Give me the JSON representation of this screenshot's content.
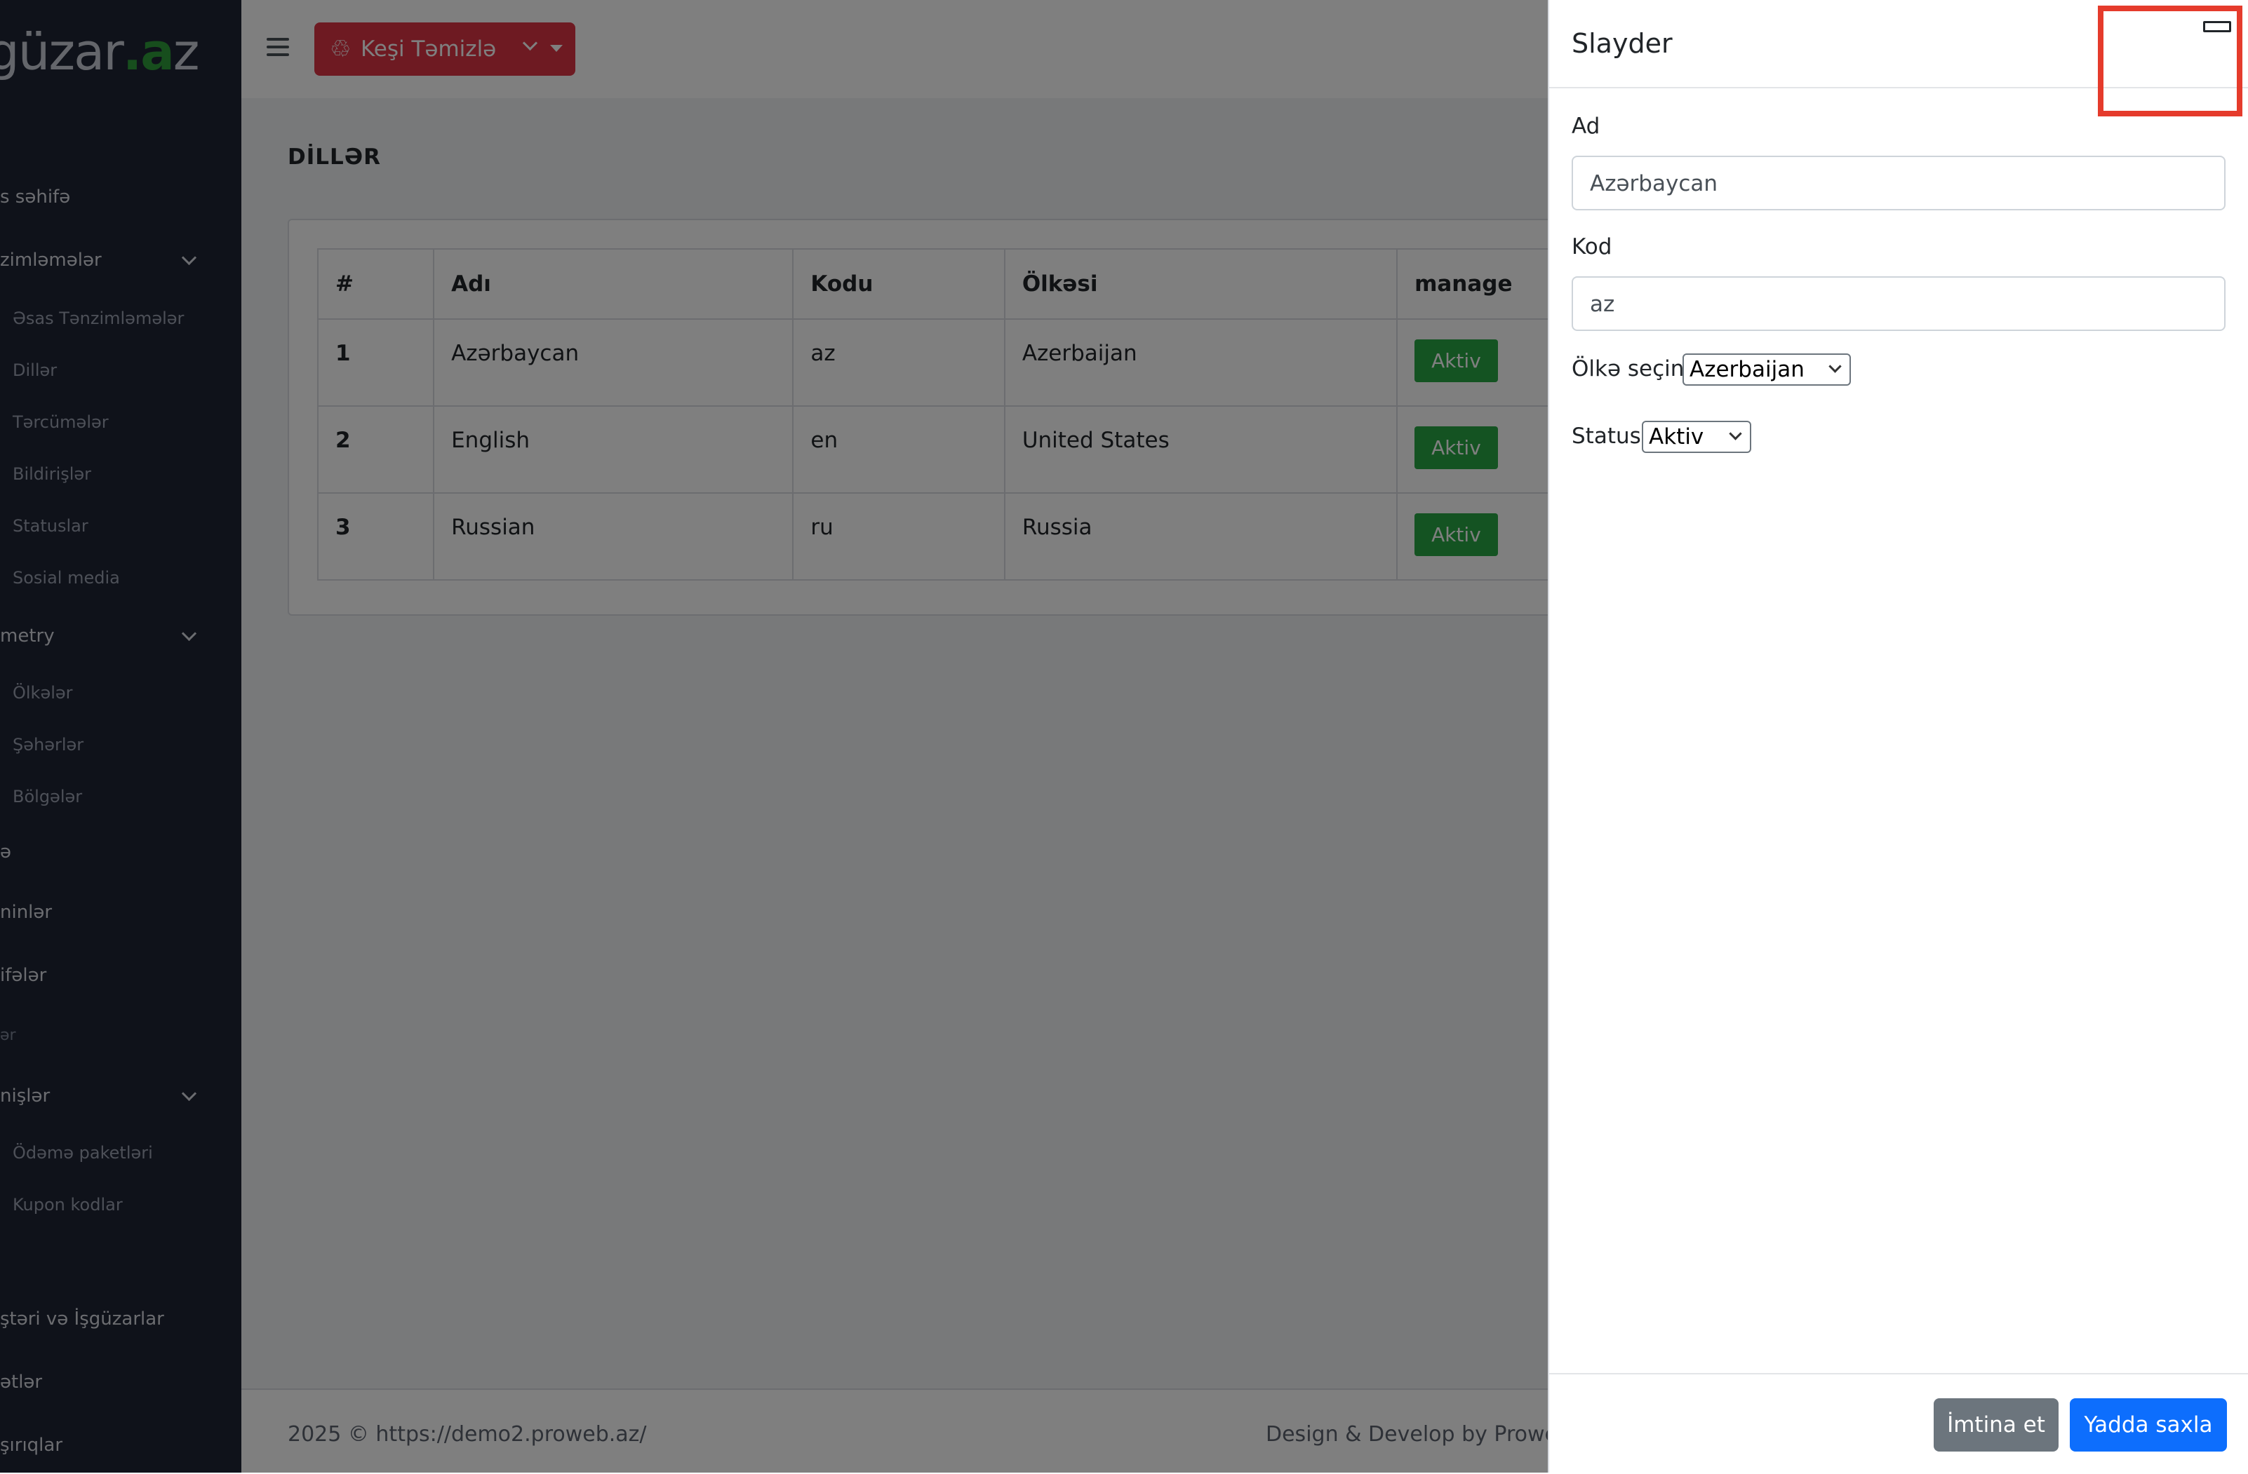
{
  "sidebar": {
    "logo_text": "güzar",
    "logo_dot": ".a",
    "logo_suffix": "z",
    "items": [
      {
        "label": "s səhifə"
      },
      {
        "label": "zimləmələr"
      },
      {
        "label": "Əsas Tənzimləmələr"
      },
      {
        "label": "Dillər"
      },
      {
        "label": "Tərcümələr"
      },
      {
        "label": "Bildirişlər"
      },
      {
        "label": "Statuslar"
      },
      {
        "label": "Sosial media"
      },
      {
        "label": "metry"
      },
      {
        "label": "Ölkələr"
      },
      {
        "label": "Şəhərlər"
      },
      {
        "label": "Bölgələr"
      },
      {
        "label": "ə"
      },
      {
        "label": "ninlər"
      },
      {
        "label": "ifələr"
      },
      {
        "label": "ər"
      },
      {
        "label": "nişlər"
      },
      {
        "label": "Ödəmə paketləri"
      },
      {
        "label": "Kupon kodlar"
      },
      {
        "label": "ştəri və İşgüzarlar"
      },
      {
        "label": "ətlər"
      },
      {
        "label": "şırıqlar"
      }
    ]
  },
  "topbar": {
    "cache_button_label": "Keşi Təmizlə"
  },
  "page": {
    "title": "DİLLƏR",
    "table": {
      "headers": [
        "#",
        "Adı",
        "Kodu",
        "Ölkəsi",
        "manage"
      ],
      "rows": [
        {
          "num": "1",
          "name": "Azərbaycan",
          "code": "az",
          "country": "Azerbaijan",
          "status": "Aktiv"
        },
        {
          "num": "2",
          "name": "English",
          "code": "en",
          "country": "United States",
          "status": "Aktiv"
        },
        {
          "num": "3",
          "name": "Russian",
          "code": "ru",
          "country": "Russia",
          "status": "Aktiv"
        }
      ]
    }
  },
  "footer": {
    "left": "2025 © https://demo2.proweb.az/",
    "right": "Design & Develop by Prowe"
  },
  "drawer": {
    "title": "Slayder",
    "name_label": "Ad",
    "name_value": "Azərbaycan",
    "code_label": "Kod",
    "code_value": "az",
    "country_label": "Ölkə seçin",
    "country_value": "Azerbaijan",
    "status_label": "Status",
    "status_value": "Aktiv",
    "cancel_label": "İmtina et",
    "save_label": "Yadda saxla"
  },
  "colors": {
    "sidebar_bg": "#1f2535",
    "danger": "#dc3545",
    "success": "#28a745",
    "primary": "#0d6efd",
    "secondary": "#6c757d",
    "highlight": "#e53b2c"
  }
}
